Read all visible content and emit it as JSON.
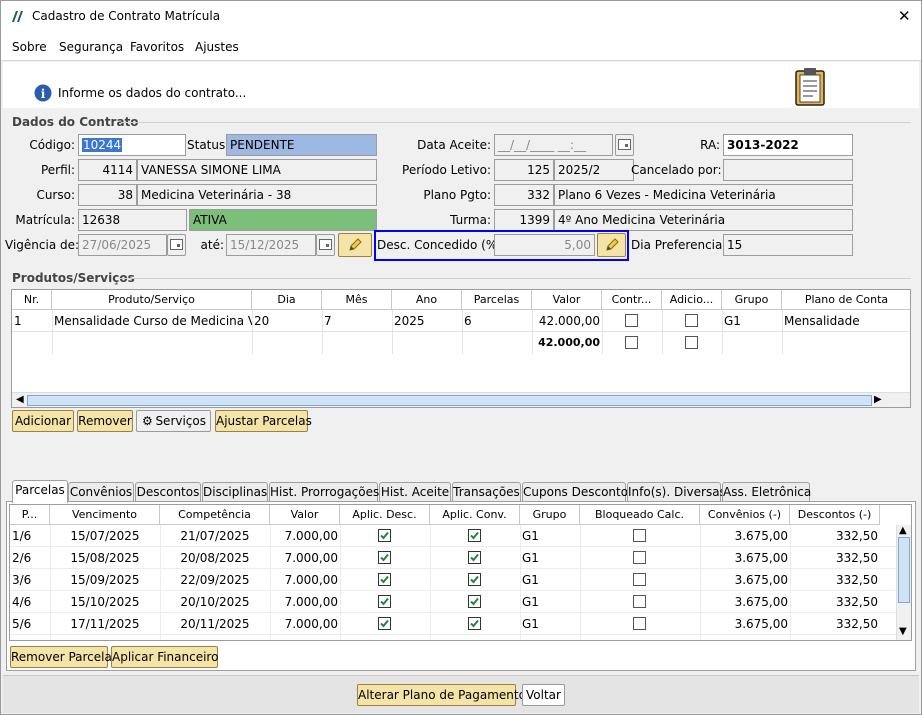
{
  "window": {
    "title": "Cadastro de Contrato Matrícula",
    "close": "✕"
  },
  "menu": [
    "Sobre",
    "Segurança",
    "Favoritos",
    "Ajustes"
  ],
  "info": {
    "text": "Informe os dados do contrato..."
  },
  "dados": {
    "group_label": "Dados do Contrato",
    "codigo_label": "Código:",
    "codigo": "10244",
    "status_label": "Status:",
    "status": "PENDENTE",
    "data_aceite_label": "Data Aceite:",
    "data_aceite": "__/__/____ __:__",
    "ra_label": "RA:",
    "ra": "3013-2022",
    "perfil_label": "Perfil:",
    "perfil_id": "4114",
    "perfil_nome": "VANESSA SIMONE LIMA",
    "periodo_label": "Período Letivo:",
    "periodo_id": "125",
    "periodo": "2025/2",
    "cancelado_label": "Cancelado por:",
    "cancelado": "",
    "curso_label": "Curso:",
    "curso_id": "38",
    "curso": "Medicina Veterinária - 38",
    "plano_label": "Plano Pgto:",
    "plano_id": "332",
    "plano": "Plano 6 Vezes - Medicina Veterinária",
    "matricula_label": "Matrícula:",
    "matricula": "12638",
    "matricula_status": "ATIVA",
    "turma_label": "Turma:",
    "turma_id": "1399",
    "turma": "4º Ano Medicina Veterinária",
    "vigencia_label": "Vigência de:",
    "vigencia_de": "27/06/2025",
    "ate_label": "até:",
    "ate": "15/12/2025",
    "desc_label": "Desc. Concedido (%):",
    "desc": "5,00",
    "dia_pref_label": "Dia Preferencial:",
    "dia_pref": "15"
  },
  "produtos": {
    "group_label": "Produtos/Serviços",
    "headers": [
      "Nr.",
      "Produto/Serviço",
      "Dia",
      "Mês",
      "Ano",
      "Parcelas",
      "Valor",
      "Contr...",
      "Adicio...",
      "Grupo",
      "Plano de Conta"
    ],
    "row": {
      "nr": "1",
      "produto": "Mensalidade Curso de Medicina Ve...",
      "dia": "20",
      "mes": "7",
      "ano": "2025",
      "parcelas": "6",
      "valor": "42.000,00",
      "grupo": "G1",
      "plano": "Mensalidade"
    },
    "total": "42.000,00",
    "buttons": {
      "adicionar": "Adicionar",
      "remover": "Remover",
      "servicos": "Serviços",
      "ajustar": "Ajustar Parcelas"
    }
  },
  "tabs": [
    "Parcelas",
    "Convênios",
    "Descontos",
    "Disciplinas",
    "Hist. Prorrogações",
    "Hist. Aceite",
    "Transações",
    "Cupons Desconto",
    "Info(s). Diversas",
    "Ass. Eletrônica"
  ],
  "parcelas": {
    "headers": [
      "P...",
      "Vencimento",
      "Competência",
      "Valor",
      "Aplic. Desc.",
      "Aplic. Conv.",
      "Grupo",
      "Bloqueado Calc.",
      "Convênios (-)",
      "Descontos (-)"
    ],
    "rows": [
      {
        "p": "1/6",
        "venc": "15/07/2025",
        "comp": "21/07/2025",
        "valor": "7.000,00",
        "grupo": "G1",
        "conv": "3.675,00",
        "desc": "332,50"
      },
      {
        "p": "2/6",
        "venc": "15/08/2025",
        "comp": "20/08/2025",
        "valor": "7.000,00",
        "grupo": "G1",
        "conv": "3.675,00",
        "desc": "332,50"
      },
      {
        "p": "3/6",
        "venc": "15/09/2025",
        "comp": "22/09/2025",
        "valor": "7.000,00",
        "grupo": "G1",
        "conv": "3.675,00",
        "desc": "332,50"
      },
      {
        "p": "4/6",
        "venc": "15/10/2025",
        "comp": "20/10/2025",
        "valor": "7.000,00",
        "grupo": "G1",
        "conv": "3.675,00",
        "desc": "332,50"
      },
      {
        "p": "5/6",
        "venc": "17/11/2025",
        "comp": "20/11/2025",
        "valor": "7.000,00",
        "grupo": "G1",
        "conv": "3.675,00",
        "desc": "332,50"
      }
    ],
    "buttons": {
      "remover": "Remover Parcela",
      "aplicar": "Aplicar Financeiro"
    }
  },
  "footer": {
    "alterar": "Alterar Plano de Pagamento",
    "voltar": "Voltar"
  },
  "colors": {
    "status_bg": "#9db9e3",
    "ativa_bg": "#7bbf7b",
    "highlight": "#0000ff",
    "button_bg": "#f4e4a8"
  }
}
